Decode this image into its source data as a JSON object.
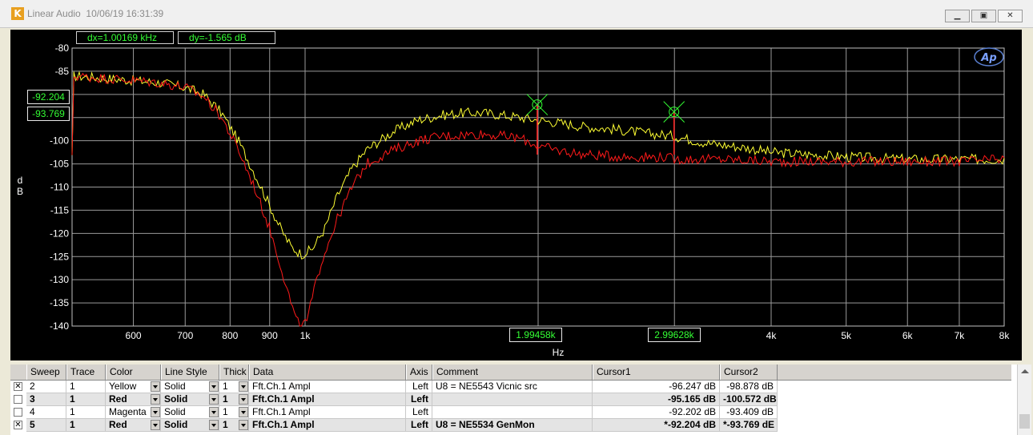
{
  "window": {
    "title": "Linear Audio",
    "timestamp": "10/06/19 16:31:39",
    "minimize_icon": "minimize-icon",
    "maximize_icon": "maximize-icon",
    "close_icon": "close-icon"
  },
  "readouts": {
    "dx": "dx=1.00169 kHz",
    "dy": "dy=-1.565  dB",
    "cursor1_y": "-92.204",
    "cursor2_y": "-93.769",
    "cursor1_x": "1.99458k",
    "cursor2_x": "2.99628k"
  },
  "chart_data": {
    "type": "line",
    "xlabel": "Hz",
    "ylabel": "dB",
    "xscale": "log",
    "xlim": [
      500,
      8000
    ],
    "ylim": [
      -140,
      -80
    ],
    "x_ticks": [
      {
        "value": 600,
        "label": "600"
      },
      {
        "value": 700,
        "label": "700"
      },
      {
        "value": 800,
        "label": "800"
      },
      {
        "value": 900,
        "label": "900"
      },
      {
        "value": 1000,
        "label": "1k"
      },
      {
        "value": 2000,
        "label": "2k"
      },
      {
        "value": 3000,
        "label": "3k"
      },
      {
        "value": 4000,
        "label": "4k"
      },
      {
        "value": 5000,
        "label": "5k"
      },
      {
        "value": 6000,
        "label": "6k"
      },
      {
        "value": 7000,
        "label": "7k"
      },
      {
        "value": 8000,
        "label": "8k"
      }
    ],
    "y_ticks": [
      -80,
      -85,
      -90,
      -95,
      -100,
      -105,
      -110,
      -115,
      -120,
      -125,
      -130,
      -135,
      -140
    ],
    "grid": true,
    "series": [
      {
        "color": "#ffff33",
        "points": [
          [
            500,
            -86
          ],
          [
            550,
            -86.5
          ],
          [
            600,
            -87
          ],
          [
            650,
            -87.5
          ],
          [
            700,
            -88.5
          ],
          [
            740,
            -90
          ],
          [
            780,
            -94
          ],
          [
            820,
            -100
          ],
          [
            860,
            -107
          ],
          [
            900,
            -114
          ],
          [
            930,
            -119
          ],
          [
            960,
            -123
          ],
          [
            990,
            -124.5
          ],
          [
            1020,
            -123.5
          ],
          [
            1060,
            -119
          ],
          [
            1100,
            -112
          ],
          [
            1150,
            -106
          ],
          [
            1200,
            -102
          ],
          [
            1300,
            -98
          ],
          [
            1400,
            -95.5
          ],
          [
            1500,
            -94.5
          ],
          [
            1600,
            -94
          ],
          [
            1700,
            -94
          ],
          [
            1800,
            -94.5
          ],
          [
            1900,
            -95
          ],
          [
            1990,
            -95.5
          ],
          [
            2100,
            -96
          ],
          [
            2300,
            -97
          ],
          [
            2500,
            -97.5
          ],
          [
            2800,
            -98.5
          ],
          [
            3000,
            -99
          ],
          [
            3300,
            -100.5
          ],
          [
            3700,
            -101.5
          ],
          [
            4000,
            -102.5
          ],
          [
            4500,
            -103
          ],
          [
            5000,
            -103.5
          ],
          [
            6000,
            -104
          ],
          [
            7000,
            -104
          ],
          [
            8000,
            -104
          ]
        ]
      },
      {
        "color": "#ff1a1a",
        "points": [
          [
            500,
            -86
          ],
          [
            550,
            -86.5
          ],
          [
            600,
            -87
          ],
          [
            650,
            -87.5
          ],
          [
            700,
            -88.5
          ],
          [
            740,
            -90.5
          ],
          [
            780,
            -95
          ],
          [
            820,
            -102
          ],
          [
            860,
            -110
          ],
          [
            900,
            -119
          ],
          [
            930,
            -127
          ],
          [
            955,
            -134
          ],
          [
            975,
            -139
          ],
          [
            990,
            -140
          ],
          [
            1005,
            -139
          ],
          [
            1025,
            -133
          ],
          [
            1050,
            -126
          ],
          [
            1100,
            -117
          ],
          [
            1150,
            -110
          ],
          [
            1200,
            -105
          ],
          [
            1300,
            -102
          ],
          [
            1400,
            -100
          ],
          [
            1500,
            -99
          ],
          [
            1700,
            -98.5
          ],
          [
            1900,
            -99.5
          ],
          [
            1990,
            -101
          ],
          [
            2100,
            -102
          ],
          [
            2300,
            -103
          ],
          [
            2600,
            -103.5
          ],
          [
            2900,
            -103.5
          ],
          [
            3000,
            -104
          ],
          [
            3500,
            -104
          ],
          [
            4000,
            -104.5
          ],
          [
            5000,
            -104.5
          ],
          [
            6000,
            -104.5
          ],
          [
            7000,
            -104.5
          ],
          [
            8000,
            -104
          ]
        ]
      }
    ],
    "markers": [
      {
        "x": 1994.58,
        "y": -92.204
      },
      {
        "x": 2996.28,
        "y": -93.769
      }
    ]
  },
  "table": {
    "columns": [
      "Sweep",
      "Trace",
      "Color",
      "Line Style",
      "Thick",
      "Data",
      "Axis",
      "Comment",
      "Cursor1",
      "Cursor2"
    ],
    "rows": [
      {
        "checked": "✕",
        "sweep": "2",
        "trace": "1",
        "color": "Yellow",
        "style": "Solid",
        "thick": "1",
        "data": "Fft.Ch.1 Ampl",
        "axis": "Left",
        "comment": "U8 = NE5543 Vicnic src",
        "cursor1": "-96.247  dB",
        "cursor2": "-98.878  dB"
      },
      {
        "checked": "",
        "sweep": "3",
        "trace": "1",
        "color": "Red",
        "style": "Solid",
        "thick": "1",
        "data": "Fft.Ch.1 Ampl",
        "axis": "Left",
        "comment": "",
        "cursor1": "-95.165  dB",
        "cursor2": "-100.572  dB"
      },
      {
        "checked": "",
        "sweep": "4",
        "trace": "1",
        "color": "Magenta",
        "style": "Solid",
        "thick": "1",
        "data": "Fft.Ch.1 Ampl",
        "axis": "Left",
        "comment": "",
        "cursor1": "-92.202  dB",
        "cursor2": "-93.409  dB"
      },
      {
        "checked": "✕",
        "sweep": "5",
        "trace": "1",
        "color": "Red",
        "style": "Solid",
        "thick": "1",
        "data": "Fft.Ch.1 Ampl",
        "axis": "Left",
        "comment": "U8 = NE5534 GenMon",
        "cursor1": "*-92.204  dB",
        "cursor2": "*-93.769  dE"
      }
    ]
  }
}
